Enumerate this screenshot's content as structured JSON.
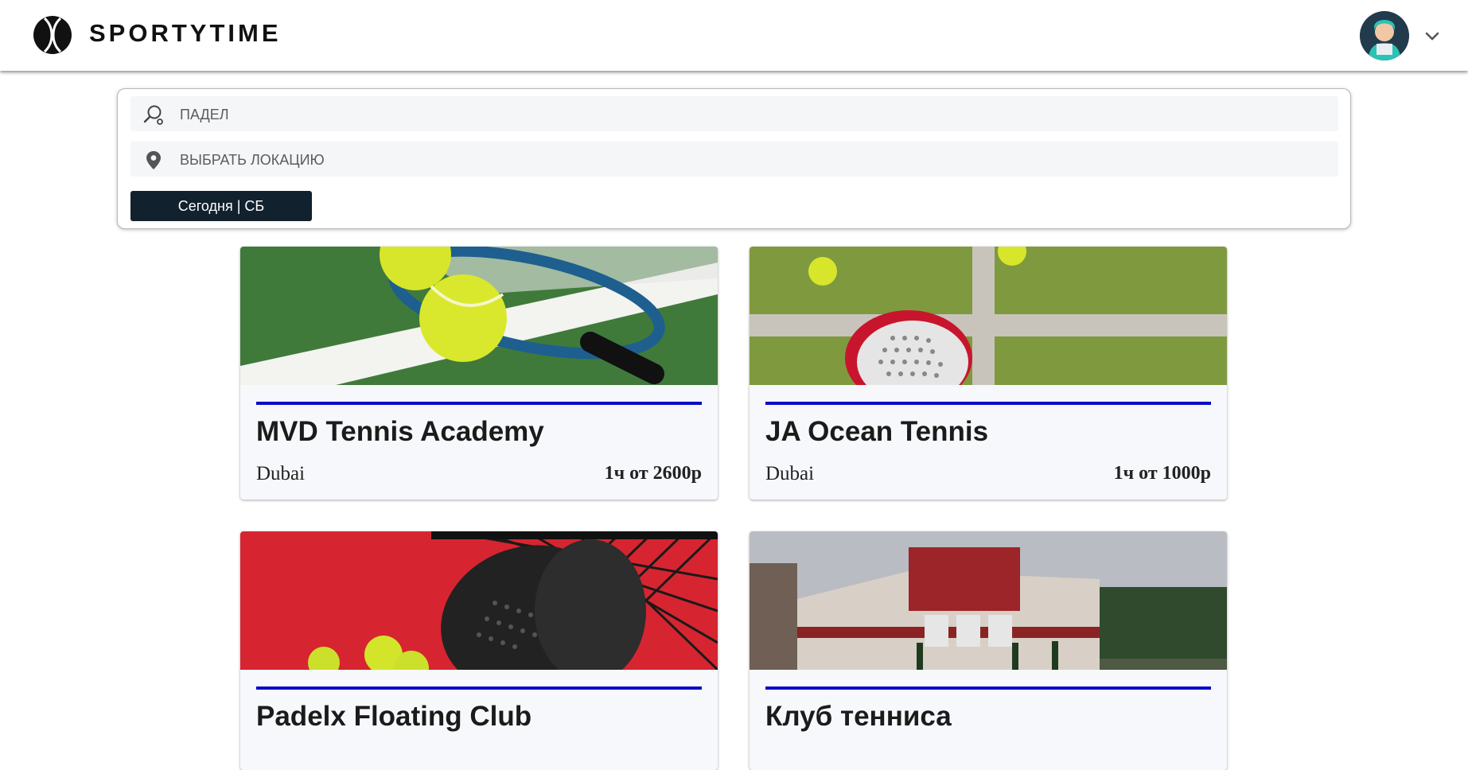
{
  "header": {
    "brand": "SPORTYTIME",
    "logo_icon": "tennis-ball-logo-icon",
    "avatar_icon": "user-avatar-icon",
    "menu_icon": "chevron-down-icon"
  },
  "search": {
    "sport_placeholder": "ПАДЕЛ",
    "sport_icon": "racket-search-icon",
    "location_placeholder": "ВЫБРАТЬ ЛОКАЦИЮ",
    "location_icon": "location-pin-icon",
    "date_button": "Сегодня | СБ"
  },
  "colors": {
    "accent_rule": "#0b0bc8",
    "button_bg": "#12212e",
    "card_bg": "#f7f8fc"
  },
  "venues": [
    {
      "name": "MVD Tennis Academy",
      "city": "Dubai",
      "price": "1ч от 2600р",
      "image": "tennis-racket-balls-photo"
    },
    {
      "name": "JA Ocean Tennis",
      "city": "Dubai",
      "price": "1ч от 1000р",
      "image": "padel-racket-grass-photo"
    },
    {
      "name": "Padelx Floating Club",
      "city": "",
      "price": "",
      "image": "padel-racket-net-photo"
    },
    {
      "name": "Клуб тенниса",
      "city": "",
      "price": "",
      "image": "tennis-club-building-photo"
    }
  ]
}
